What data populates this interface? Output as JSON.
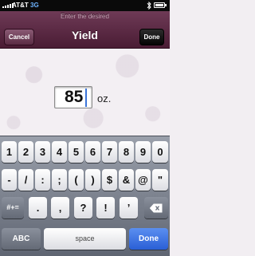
{
  "status_bar": {
    "carrier": "AT&T",
    "network": "3G",
    "time": "",
    "bluetooth_icon": "bluetooth-icon",
    "battery_icon": "battery-icon"
  },
  "nav": {
    "prompt": "Enter the desired",
    "title": "Yield",
    "cancel_label": "Cancel",
    "done_label": "Done"
  },
  "yield_field": {
    "value": "85",
    "unit": "oz."
  },
  "keyboard": {
    "row1": [
      "1",
      "2",
      "3",
      "4",
      "5",
      "6",
      "7",
      "8",
      "9",
      "0"
    ],
    "row2": [
      "-",
      "/",
      ":",
      ";",
      "(",
      ")",
      "$",
      "&",
      "@",
      "\""
    ],
    "mode_label": "#+=",
    "row3": [
      ".",
      ",",
      "?",
      "!",
      "’"
    ],
    "delete_icon": "backspace-icon",
    "abc_label": "ABC",
    "space_label": "space",
    "done_label": "Done"
  },
  "colors": {
    "nav_bar": "#5a2a44",
    "keyboard_bg": "#7c828d",
    "done_key": "#2a5fd6",
    "network_3g": "#6fb5ff"
  }
}
